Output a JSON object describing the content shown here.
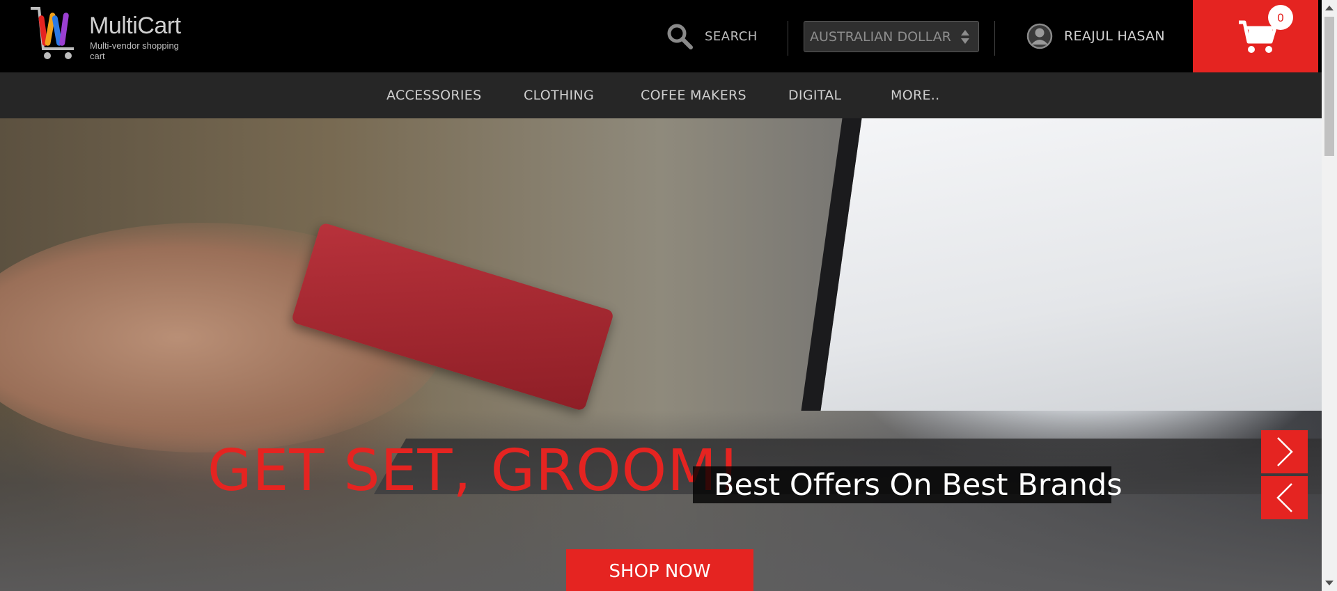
{
  "logo": {
    "name": "MultiCart",
    "tagline": "Multi-vendor shopping cart"
  },
  "header": {
    "search_label": "SEARCH",
    "currency_selected": "AUSTRALIAN DOLLAR",
    "user_name": "REAJUL HASAN",
    "cart_count": "0"
  },
  "nav": {
    "items": [
      "ACCESSORIES",
      "CLOTHING",
      "COFEE MAKERS",
      "DIGITAL",
      "MORE.."
    ]
  },
  "hero": {
    "headline": "GET SET, GROOM!",
    "subheadline": "Best Offers On Best Brands",
    "cta_label": "SHOP NOW"
  },
  "colors": {
    "accent": "#e52421",
    "topbar": "#000000",
    "navbar": "#262626"
  },
  "icons": [
    "search-icon",
    "sort-arrows-icon",
    "user-icon",
    "cart-icon",
    "chevron-right-icon",
    "chevron-left-icon"
  ]
}
